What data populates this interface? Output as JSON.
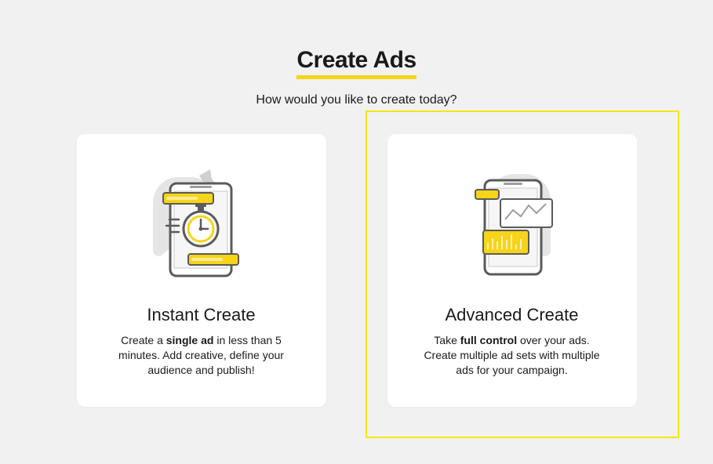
{
  "header": {
    "title": "Create Ads",
    "subtitle": "How would you like to create today?"
  },
  "cards": {
    "instant": {
      "title": "Instant Create",
      "desc_pre": "Create a ",
      "desc_bold": "single ad",
      "desc_post": " in less than 5 minutes. Add creative, define your audience and publish!"
    },
    "advanced": {
      "title": "Advanced Create",
      "desc_pre": "Take ",
      "desc_bold": "full control",
      "desc_post": " over your ads. Create multiple ad sets with multiple ads for your campaign."
    }
  }
}
